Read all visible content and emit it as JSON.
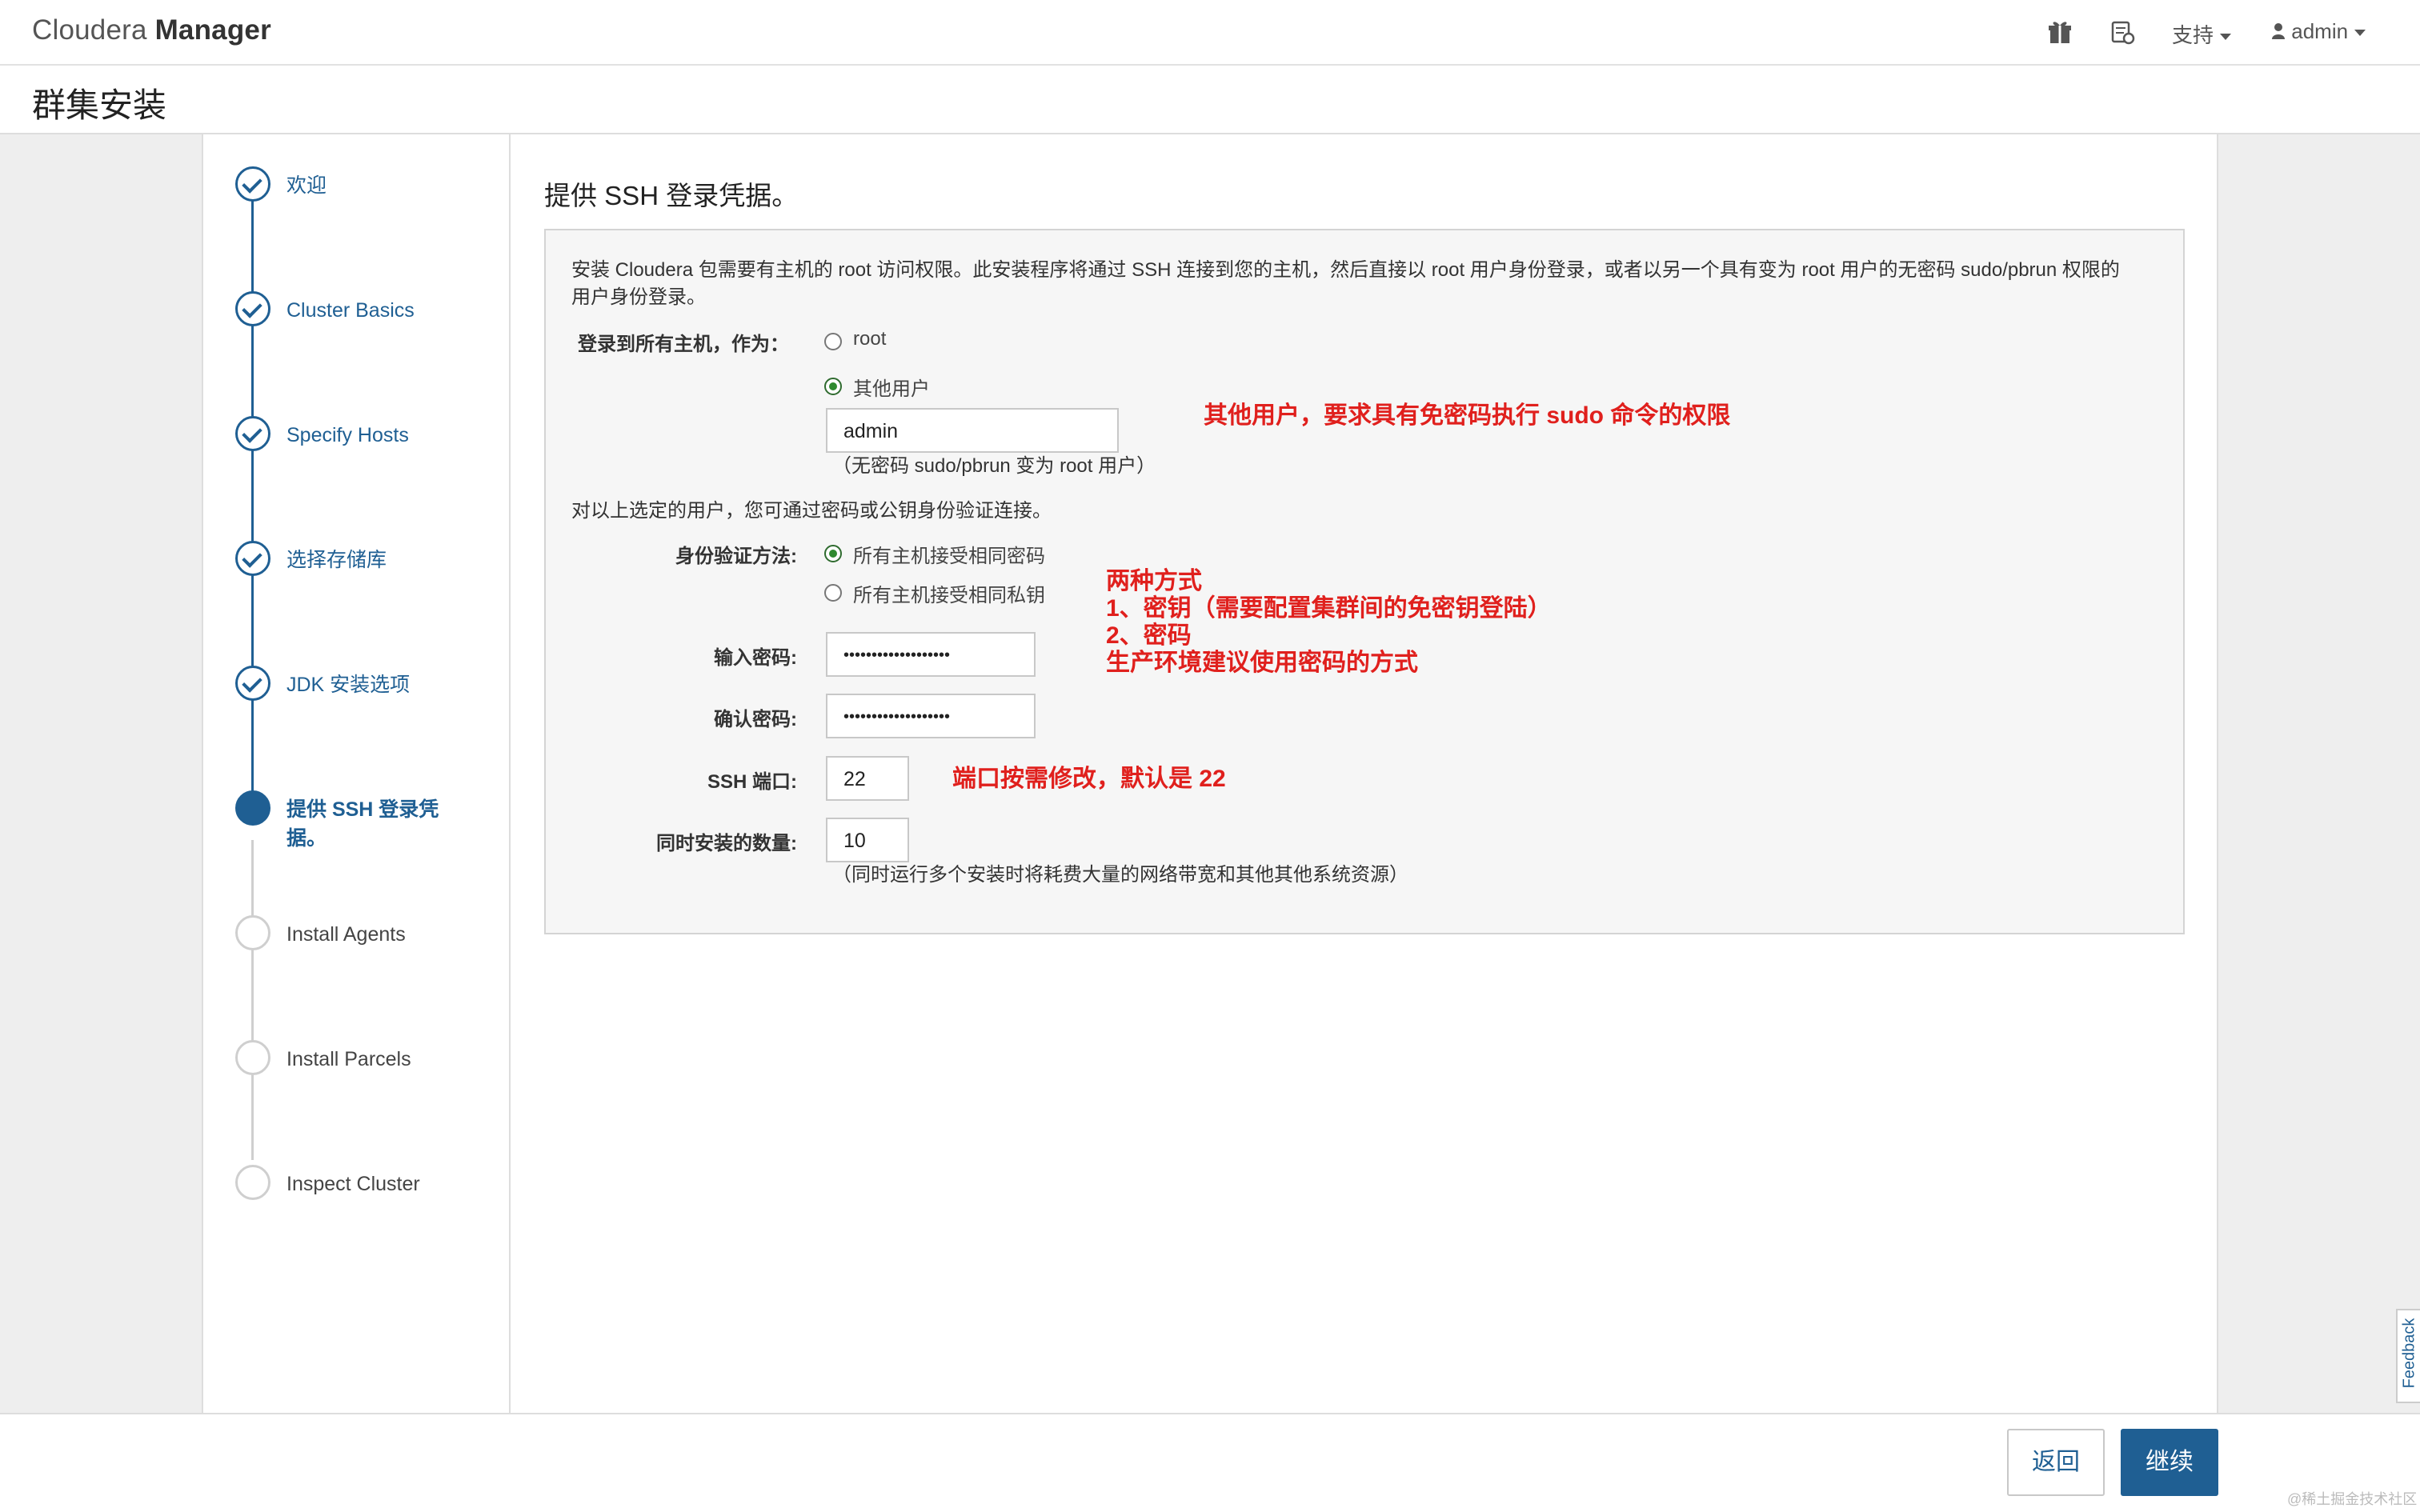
{
  "navbar": {
    "brand_light": "Cloudera",
    "brand_bold": "Manager",
    "support": "支持",
    "user": "admin"
  },
  "page": {
    "title": "群集安装"
  },
  "steps": [
    {
      "label": "欢迎",
      "state": "done"
    },
    {
      "label": "Cluster Basics",
      "state": "done"
    },
    {
      "label": "Specify Hosts",
      "state": "done"
    },
    {
      "label": "选择存储库",
      "state": "done"
    },
    {
      "label": "JDK 安装选项",
      "state": "done"
    },
    {
      "label": "提供 SSH 登录凭据。",
      "state": "active"
    },
    {
      "label": "Install Agents",
      "state": "pending"
    },
    {
      "label": "Install Parcels",
      "state": "pending"
    },
    {
      "label": "Inspect Cluster",
      "state": "pending"
    }
  ],
  "main": {
    "section_title": "提供 SSH 登录凭据。",
    "intro_line1": "安装 Cloudera 包需要有主机的 root 访问权限。此安装程序将通过 SSH 连接到您的主机，然后直接以 root 用户身份登录，或者以另一个具有变为 root 用户的无密码 sudo/pbrun 权限的",
    "intro_line2": "用户身份登录。",
    "login_as_label": "登录到所有主机，作为：",
    "login_option_root": "root",
    "login_option_other": "其他用户",
    "username_value": "admin",
    "username_hint": "（无密码 sudo/pbrun 变为 root 用户）",
    "auth_intro": "对以上选定的用户，您可通过密码或公钥身份验证连接。",
    "auth_method_label": "身份验证方法:",
    "auth_option_password": "所有主机接受相同密码",
    "auth_option_key": "所有主机接受相同私钥",
    "password_label": "输入密码:",
    "password_value": "•••••••••••••••••••",
    "confirm_label": "确认密码:",
    "confirm_value": "•••••••••••••••••••",
    "ssh_port_label": "SSH 端口:",
    "ssh_port_value": "22",
    "concurrent_label": "同时安装的数量:",
    "concurrent_value": "10",
    "concurrent_hint": "（同时运行多个安装时将耗费大量的网络带宽和其他其他系统资源）"
  },
  "annotations": {
    "other_user": "其他用户，要求具有免密码执行 sudo 命令的权限",
    "auth_line1": "两种方式",
    "auth_line2": "1、密钥（需要配置集群间的免密钥登陆）",
    "auth_line3": "2、密码",
    "auth_line4": "生产环境建议使用密码的方式",
    "port": "端口按需修改，默认是 22"
  },
  "footer": {
    "back": "返回",
    "next": "继续"
  },
  "feedback": "Feedback",
  "watermark": "@稀土掘金技术社区",
  "colors": {
    "primary": "#1f5f93",
    "annotation": "#e0201d",
    "radio_on": "#2f8a2f"
  }
}
